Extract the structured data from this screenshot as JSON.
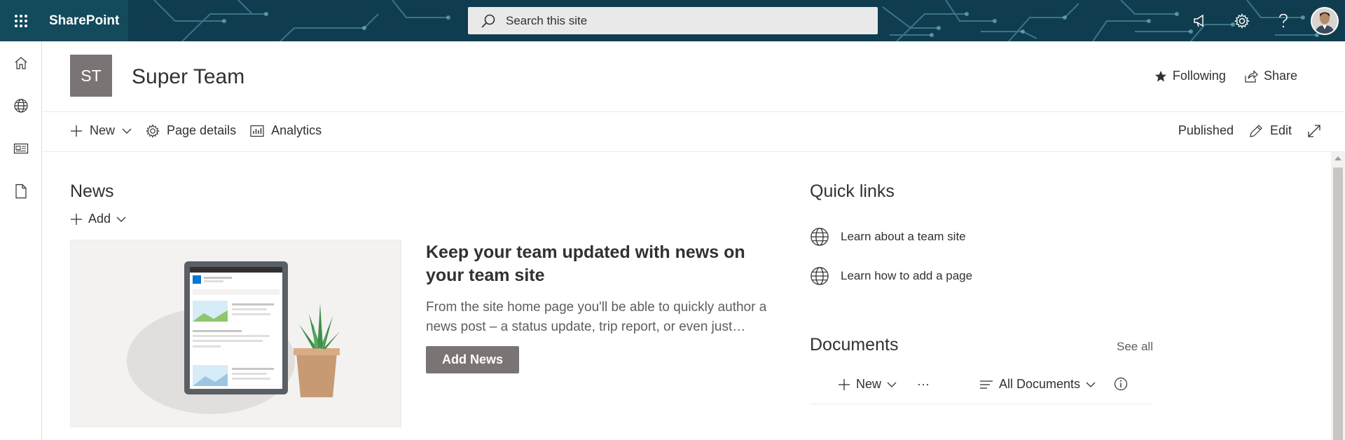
{
  "suite_bar": {
    "app_name": "SharePoint",
    "search_placeholder": "Search this site",
    "icons": [
      "waffle-icon",
      "megaphone-icon",
      "gear-icon",
      "help-icon"
    ]
  },
  "app_bar": {
    "items": [
      "home-icon",
      "globe-icon",
      "news-icon",
      "document-icon"
    ]
  },
  "site_header": {
    "logo_initials": "ST",
    "title": "Super Team",
    "following_label": "Following",
    "share_label": "Share"
  },
  "command_bar": {
    "new_label": "New",
    "page_details_label": "Page details",
    "analytics_label": "Analytics",
    "status_label": "Published",
    "edit_label": "Edit"
  },
  "news": {
    "title": "News",
    "add_label": "Add",
    "headline": "Keep your team updated with news on your team site",
    "description": "From the site home page you'll be able to quickly author a news post – a status update, trip report, or even just…",
    "button_label": "Add News"
  },
  "quick_links": {
    "title": "Quick links",
    "items": [
      {
        "label": "Learn about a team site",
        "icon": "globe-icon"
      },
      {
        "label": "Learn how to add a page",
        "icon": "globe-icon"
      }
    ]
  },
  "documents": {
    "title": "Documents",
    "see_all_label": "See all",
    "new_label": "New",
    "more_label": "···",
    "view_label": "All Documents"
  },
  "colors": {
    "suite_bar_bg": "#0f3d4f",
    "site_logo_bg": "#7a7574",
    "button_bg": "#7a7574"
  }
}
